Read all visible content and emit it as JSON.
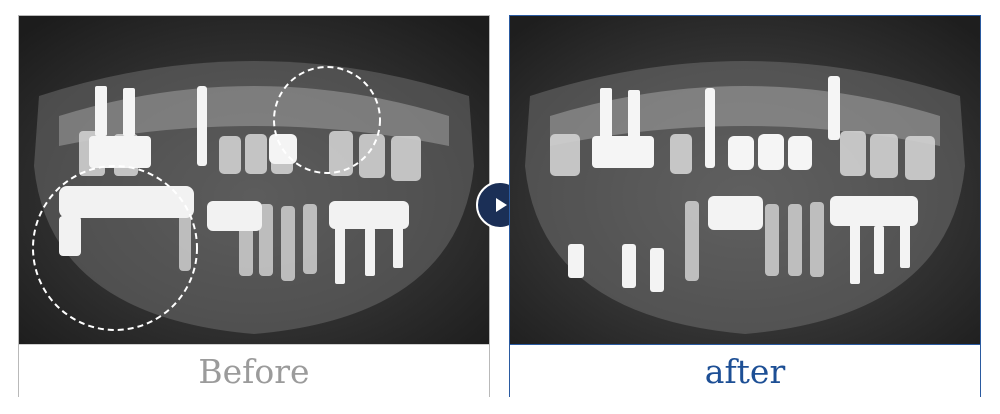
{
  "before": {
    "caption": "Before"
  },
  "after": {
    "caption": "after"
  },
  "navigation": {
    "icon": "play-arrow-icon"
  },
  "colors": {
    "before_caption": "#9b9b9b",
    "after_caption": "#1d4f95",
    "after_border": "#2a5aa0",
    "arrow_button": "#1b2f56"
  }
}
